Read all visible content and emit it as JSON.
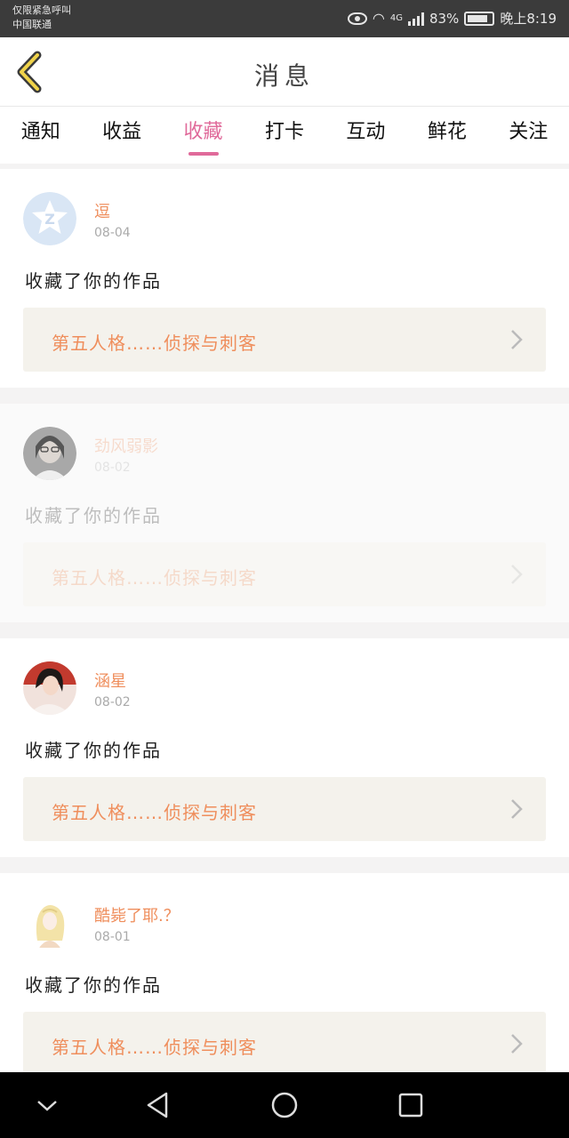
{
  "status_bar": {
    "line1": "仅限紧急呼叫",
    "line2": "中国联通",
    "network": "4G",
    "battery": "83%",
    "time": "晚上8:19"
  },
  "header": {
    "title": "消息",
    "back_icon": "chevron-left-icon"
  },
  "tabs": [
    {
      "label": "通知",
      "active": false
    },
    {
      "label": "收益",
      "active": false
    },
    {
      "label": "收藏",
      "active": true
    },
    {
      "label": "打卡",
      "active": false
    },
    {
      "label": "互动",
      "active": false
    },
    {
      "label": "鲜花",
      "active": false
    },
    {
      "label": "关注",
      "active": false
    }
  ],
  "notifications": [
    {
      "name": "逗",
      "date": "08-04",
      "action": "收藏了你的作品",
      "work_title": "第五人格……侦探与刺客",
      "faded": false
    },
    {
      "name": "劲风弱影",
      "date": "08-02",
      "action": "收藏了你的作品",
      "work_title": "第五人格……侦探与刺客",
      "faded": true
    },
    {
      "name": "涵星",
      "date": "08-02",
      "action": "收藏了你的作品",
      "work_title": "第五人格……侦探与刺客",
      "faded": false
    },
    {
      "name": "酷毙了耶.？",
      "date": "08-01",
      "action": "收藏了你的作品",
      "work_title": "第五人格……侦探与刺客",
      "faded": false
    }
  ],
  "colors": {
    "accent": "#e06a9a",
    "name_orange": "#ef8e5c",
    "card_link_bg": "#f4f2ec"
  },
  "nav_icons": [
    "chevron-down-icon",
    "back-triangle-icon",
    "home-circle-icon",
    "recents-square-icon"
  ]
}
